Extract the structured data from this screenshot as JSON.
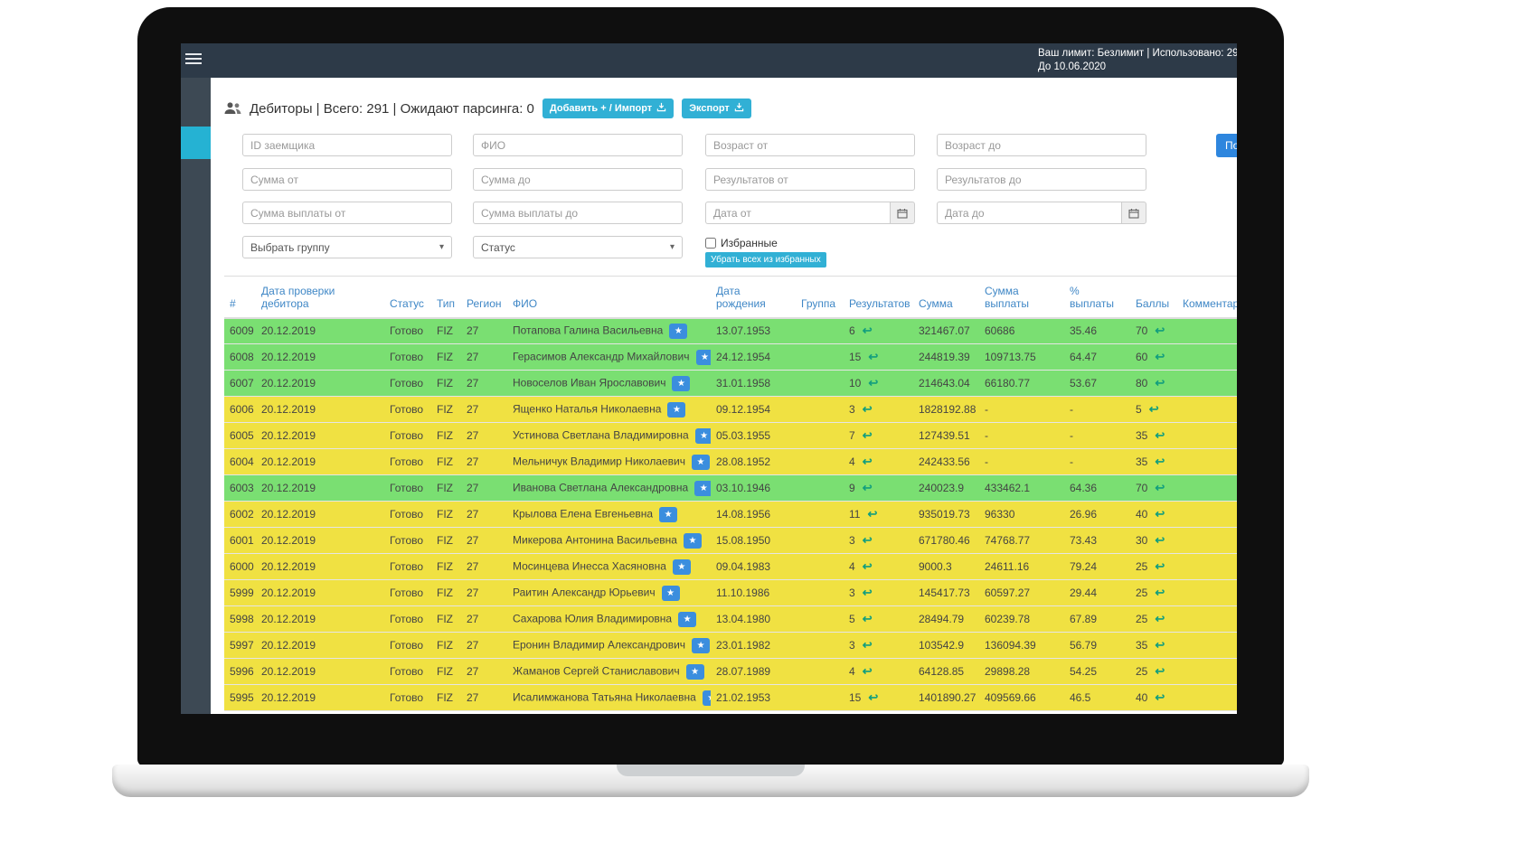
{
  "colors": {
    "navbar": "#2d3a48",
    "sidebar": "#3d4954",
    "sidebar-active": "#25b2d3",
    "accent": "#31b0d5",
    "search-blue": "#2e86de",
    "header-blue": "#3f87c6",
    "green-row": "#7adf72",
    "yellow-row": "#f0e142",
    "star-blue": "#3b8ede",
    "arrow-teal": "#129e7e"
  },
  "icons": {
    "star": "★",
    "reply-arrow": "↩",
    "caret": "▾"
  },
  "topbar": {
    "line1": "Ваш лимит: Безлимит | Использовано: 29",
    "line2": "До 10.06.2020"
  },
  "page": {
    "title": "Дебиторы | Всего: 291 | Ожидают парсинга: 0",
    "buttons": {
      "add_import": "Добавить + / Импорт",
      "export": "Экспорт",
      "search": "Поиск"
    }
  },
  "filters": {
    "id_placeholder": "ID заемщика",
    "fio_placeholder": "ФИО",
    "age_from": "Возраст от",
    "age_to": "Возраст до",
    "sum_from": "Сумма от",
    "sum_to": "Сумма до",
    "results_from": "Результатов от",
    "results_to": "Результатов до",
    "payout_from": "Сумма выплаты от",
    "payout_to": "Сумма выплаты до",
    "date_from": "Дата от",
    "date_to": "Дата до",
    "group_select": "Выбрать группу",
    "status_select": "Статус",
    "favorites_label": "Избранные",
    "remove_favorites": "Убрать всех из избранных"
  },
  "table": {
    "columns": [
      "#",
      "Дата проверки дебитора",
      "Статус",
      "Тип",
      "Регион",
      "ФИО",
      "Дата рождения",
      "Группа",
      "Результатов",
      "Сумма",
      "Сумма выплаты",
      "% выплаты",
      "Баллы",
      "Комментарий"
    ],
    "rows": [
      {
        "id": "6009",
        "date": "20.12.2019",
        "status": "Готово",
        "type": "FIZ",
        "region": "27",
        "name": "Потапова Галина Васильевна",
        "birth": "13.07.1953",
        "group": "",
        "results": "6",
        "sum": "321467.07",
        "payout": "60686",
        "percent": "35.46",
        "points": "70",
        "comment": "",
        "color": "green"
      },
      {
        "id": "6008",
        "date": "20.12.2019",
        "status": "Готово",
        "type": "FIZ",
        "region": "27",
        "name": "Герасимов Александр Михайлович",
        "birth": "24.12.1954",
        "group": "",
        "results": "15",
        "sum": "244819.39",
        "payout": "109713.75",
        "percent": "64.47",
        "points": "60",
        "comment": "",
        "color": "green"
      },
      {
        "id": "6007",
        "date": "20.12.2019",
        "status": "Готово",
        "type": "FIZ",
        "region": "27",
        "name": "Новоселов Иван Ярославович",
        "birth": "31.01.1958",
        "group": "",
        "results": "10",
        "sum": "214643.04",
        "payout": "66180.77",
        "percent": "53.67",
        "points": "80",
        "comment": "",
        "color": "green"
      },
      {
        "id": "6006",
        "date": "20.12.2019",
        "status": "Готово",
        "type": "FIZ",
        "region": "27",
        "name": "Ященко Наталья Николаевна",
        "birth": "09.12.1954",
        "group": "",
        "results": "3",
        "sum": "1828192.88",
        "payout": "-",
        "percent": "-",
        "points": "5",
        "comment": "",
        "color": "yellow"
      },
      {
        "id": "6005",
        "date": "20.12.2019",
        "status": "Готово",
        "type": "FIZ",
        "region": "27",
        "name": "Устинова Светлана Владимировна",
        "birth": "05.03.1955",
        "group": "",
        "results": "7",
        "sum": "127439.51",
        "payout": "-",
        "percent": "-",
        "points": "35",
        "comment": "",
        "color": "yellow"
      },
      {
        "id": "6004",
        "date": "20.12.2019",
        "status": "Готово",
        "type": "FIZ",
        "region": "27",
        "name": "Мельничук Владимир Николаевич",
        "birth": "28.08.1952",
        "group": "",
        "results": "4",
        "sum": "242433.56",
        "payout": "-",
        "percent": "-",
        "points": "35",
        "comment": "",
        "color": "yellow"
      },
      {
        "id": "6003",
        "date": "20.12.2019",
        "status": "Готово",
        "type": "FIZ",
        "region": "27",
        "name": "Иванова Светлана Александровна",
        "birth": "03.10.1946",
        "group": "",
        "results": "9",
        "sum": "240023.9",
        "payout": "433462.1",
        "percent": "64.36",
        "points": "70",
        "comment": "",
        "color": "green"
      },
      {
        "id": "6002",
        "date": "20.12.2019",
        "status": "Готово",
        "type": "FIZ",
        "region": "27",
        "name": "Крылова Елена Евгеньевна",
        "birth": "14.08.1956",
        "group": "",
        "results": "11",
        "sum": "935019.73",
        "payout": "96330",
        "percent": "26.96",
        "points": "40",
        "comment": "",
        "color": "yellow"
      },
      {
        "id": "6001",
        "date": "20.12.2019",
        "status": "Готово",
        "type": "FIZ",
        "region": "27",
        "name": "Микерова Антонина Васильевна",
        "birth": "15.08.1950",
        "group": "",
        "results": "3",
        "sum": "671780.46",
        "payout": "74768.77",
        "percent": "73.43",
        "points": "30",
        "comment": "",
        "color": "yellow"
      },
      {
        "id": "6000",
        "date": "20.12.2019",
        "status": "Готово",
        "type": "FIZ",
        "region": "27",
        "name": "Мосинцева Инесса Хасяновна",
        "birth": "09.04.1983",
        "group": "",
        "results": "4",
        "sum": "9000.3",
        "payout": "24611.16",
        "percent": "79.24",
        "points": "25",
        "comment": "",
        "color": "yellow"
      },
      {
        "id": "5999",
        "date": "20.12.2019",
        "status": "Готово",
        "type": "FIZ",
        "region": "27",
        "name": "Раитин Александр Юрьевич",
        "birth": "11.10.1986",
        "group": "",
        "results": "3",
        "sum": "145417.73",
        "payout": "60597.27",
        "percent": "29.44",
        "points": "25",
        "comment": "",
        "color": "yellow"
      },
      {
        "id": "5998",
        "date": "20.12.2019",
        "status": "Готово",
        "type": "FIZ",
        "region": "27",
        "name": "Сахарова Юлия Владимировна",
        "birth": "13.04.1980",
        "group": "",
        "results": "5",
        "sum": "28494.79",
        "payout": "60239.78",
        "percent": "67.89",
        "points": "25",
        "comment": "",
        "color": "yellow"
      },
      {
        "id": "5997",
        "date": "20.12.2019",
        "status": "Готово",
        "type": "FIZ",
        "region": "27",
        "name": "Еронин Владимир Александрович",
        "birth": "23.01.1982",
        "group": "",
        "results": "3",
        "sum": "103542.9",
        "payout": "136094.39",
        "percent": "56.79",
        "points": "35",
        "comment": "",
        "color": "yellow"
      },
      {
        "id": "5996",
        "date": "20.12.2019",
        "status": "Готово",
        "type": "FIZ",
        "region": "27",
        "name": "Жаманов Сергей Станиславович",
        "birth": "28.07.1989",
        "group": "",
        "results": "4",
        "sum": "64128.85",
        "payout": "29898.28",
        "percent": "54.25",
        "points": "25",
        "comment": "",
        "color": "yellow"
      },
      {
        "id": "5995",
        "date": "20.12.2019",
        "status": "Готово",
        "type": "FIZ",
        "region": "27",
        "name": "Исалимжанова Татьяна Николаевна",
        "birth": "21.02.1953",
        "group": "",
        "results": "15",
        "sum": "1401890.27",
        "payout": "409569.66",
        "percent": "46.5",
        "points": "40",
        "comment": "",
        "color": "yellow"
      }
    ]
  }
}
